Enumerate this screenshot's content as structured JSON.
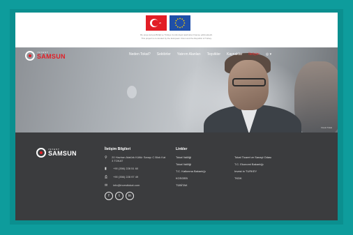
{
  "flags": {
    "note_line1": "Bu proje Avrupa Birliği ve Türkiye Cumhuriyeti tarafından finanse edilmektedir.",
    "note_line2": "This project is co-funded by the European Union and the Republic of Turkey."
  },
  "brand": {
    "small": "INVEST",
    "name": "SAMSUN"
  },
  "nav": {
    "items": [
      "Neden Tokat?",
      "Sektörler",
      "Yatırım Alanları",
      "Teşvikler",
      "Kaynaklar",
      "İletişim"
    ],
    "globe": "◎ ▾"
  },
  "hero": {
    "credit": "Invest Tokat"
  },
  "footer": {
    "contact_title": "İletişim Bilgileri",
    "contact": [
      {
        "icon": "map-pin-icon",
        "glyph": "⚲",
        "text": "20 Haziran Atatürk Kültür Sarayı C Blok Kat 3 TOKAT"
      },
      {
        "icon": "phone-icon",
        "glyph": "▮",
        "text": "+90 (356) 228 51 60"
      },
      {
        "icon": "fax-icon",
        "glyph": "⎙",
        "text": "+90 (356) 228 97 49"
      },
      {
        "icon": "mail-icon",
        "glyph": "✉",
        "text": "info@investtokat.com"
      }
    ],
    "socials": [
      {
        "icon": "facebook-icon",
        "glyph": "f"
      },
      {
        "icon": "twitter-icon",
        "glyph": "t"
      },
      {
        "icon": "linkedin-icon",
        "glyph": "in"
      }
    ],
    "links_title": "Linkler",
    "links": [
      "Tokat Valiliği",
      "Tokat Ticaret ve Sanayi Odası",
      "Tokat Valiliği",
      "T.C. Ekonomi Bakanlığı",
      "T.C. Kalkınma Bakanlığı",
      "Invest in TURKEY",
      "KOSGEB",
      "TKDK",
      "TÜBİTAK",
      ""
    ]
  }
}
